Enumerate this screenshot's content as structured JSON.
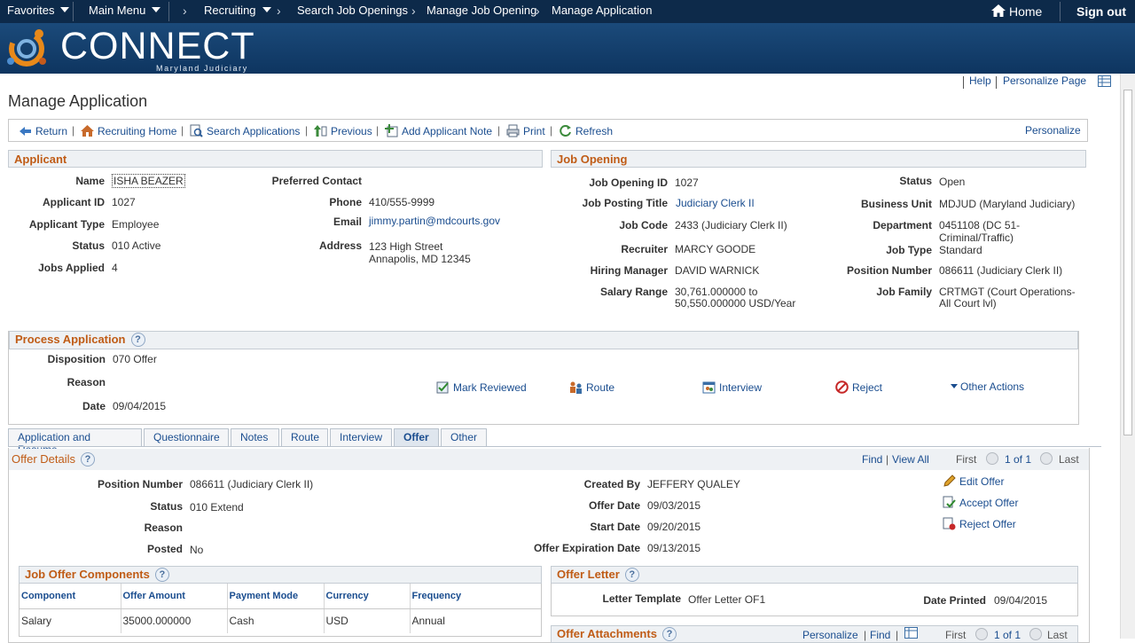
{
  "nav": {
    "favorites": "Favorites",
    "main_menu": "Main Menu",
    "crumbs": [
      "Recruiting",
      "Search Job Openings",
      "Manage Job Opening",
      "Manage Application"
    ],
    "home": "Home",
    "sign_out": "Sign out"
  },
  "banner": {
    "brand": "CONNECT",
    "sub": "Maryland Judiciary"
  },
  "header_links": {
    "help": "Help",
    "personalize_page": "Personalize Page"
  },
  "page_title": "Manage Application",
  "toolbar": {
    "return": "Return",
    "recruiting_home": "Recruiting Home",
    "search_applications": "Search Applications",
    "previous": "Previous",
    "add_note": "Add Applicant Note",
    "print": "Print",
    "refresh": "Refresh",
    "personalize": "Personalize"
  },
  "applicant": {
    "title": "Applicant",
    "name_label": "Name",
    "name": "ISHA BEAZER",
    "id_label": "Applicant ID",
    "id": "1027",
    "type_label": "Applicant Type",
    "type": "Employee",
    "status_label": "Status",
    "status": "010 Active",
    "jobs_label": "Jobs Applied",
    "jobs": "4",
    "pref_label": "Preferred Contact",
    "phone_label": "Phone",
    "phone": "410/555-9999",
    "email_label": "Email",
    "email": "jimmy.partin@mdcourts.gov",
    "address_label": "Address",
    "address1": "123 High Street",
    "address2": "Annapolis, MD 12345"
  },
  "job": {
    "title": "Job Opening",
    "id_label": "Job Opening ID",
    "id": "1027",
    "posting_label": "Job Posting Title",
    "posting": "Judiciary Clerk II",
    "code_label": "Job Code",
    "code": "2433 (Judiciary Clerk II)",
    "recruiter_label": "Recruiter",
    "recruiter": "MARCY GOODE",
    "hm_label": "Hiring Manager",
    "hm": "DAVID WARNICK",
    "salary_label": "Salary Range",
    "salary1": "30,761.000000 to",
    "salary2": "50,550.000000 USD/Year",
    "status_label": "Status",
    "status": "Open",
    "bu_label": "Business Unit",
    "bu": "MDJUD (Maryland Judiciary)",
    "dept_label": "Department",
    "dept1": "0451108 (DC 51-",
    "dept2": "Criminal/Traffic)",
    "jobtype_label": "Job Type",
    "jobtype": "Standard",
    "pos_label": "Position Number",
    "pos": "086611 (Judiciary Clerk II)",
    "family_label": "Job Family",
    "family1": "CRTMGT (Court Operations-",
    "family2": "All Court lvl)"
  },
  "process": {
    "title": "Process Application",
    "disp_label": "Disposition",
    "disp": "070 Offer",
    "reason_label": "Reason",
    "date_label": "Date",
    "date": "09/04/2015",
    "mark_reviewed": "Mark Reviewed",
    "route": "Route",
    "interview": "Interview",
    "reject": "Reject",
    "other_actions": "Other Actions"
  },
  "tabs": [
    "Application and Resume",
    "Questionnaire",
    "Notes",
    "Route",
    "Interview",
    "Offer",
    "Other"
  ],
  "offer": {
    "title": "Offer Details",
    "find": "Find",
    "view_all": "View All",
    "first": "First",
    "page": "1 of 1",
    "last": "Last",
    "pos_label": "Position Number",
    "pos": "086611 (Judiciary Clerk II)",
    "status_label": "Status",
    "status": "010 Extend",
    "reason_label": "Reason",
    "posted_label": "Posted",
    "posted": "No",
    "created_label": "Created By",
    "created": "JEFFERY QUALEY",
    "offer_date_label": "Offer Date",
    "offer_date": "09/03/2015",
    "start_label": "Start Date",
    "start": "09/20/2015",
    "exp_label": "Offer Expiration Date",
    "exp": "09/13/2015",
    "edit": "Edit Offer",
    "accept": "Accept Offer",
    "reject": "Reject Offer"
  },
  "components": {
    "title": "Job Offer Components",
    "headers": [
      "Component",
      "Offer Amount",
      "Payment Mode",
      "Currency",
      "Frequency"
    ],
    "row": [
      "Salary",
      "35000.000000",
      "Cash",
      "USD",
      "Annual"
    ]
  },
  "letter": {
    "title": "Offer Letter",
    "template_label": "Letter Template",
    "template": "Offer Letter OF1",
    "printed_label": "Date Printed",
    "printed": "09/04/2015"
  },
  "attachments": {
    "title": "Offer Attachments",
    "personalize": "Personalize",
    "find": "Find",
    "first": "First",
    "page": "1 of 1",
    "last": "Last"
  }
}
